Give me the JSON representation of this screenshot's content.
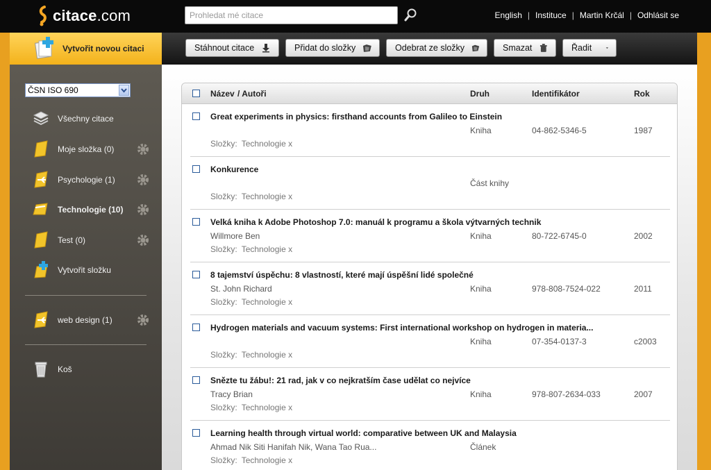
{
  "header": {
    "logo_text": "citace",
    "logo_suffix": ".com",
    "search_placeholder": "Prohledat mé citace",
    "nav": [
      "English",
      "Instituce",
      "Martin Krčál",
      "Odhlásit se"
    ]
  },
  "new_citation_label": "Vytvořit novou citaci",
  "toolbar": {
    "download": "Stáhnout citace",
    "add_to_folder": "Přidat do složky",
    "remove_from_folder": "Odebrat ze složky",
    "delete": "Smazat",
    "sort": "Řadit"
  },
  "sidebar": {
    "style_select": "ČSN ISO 690",
    "items": [
      {
        "label": "Všechny citace"
      },
      {
        "label": "Moje složka (0)"
      },
      {
        "label": "Psychologie (1)"
      },
      {
        "label": "Technologie (10)"
      },
      {
        "label": "Test (0)"
      },
      {
        "label": "Vytvořit složku"
      },
      {
        "label": "web design (1)"
      },
      {
        "label": "Koš"
      }
    ]
  },
  "list": {
    "headers": {
      "name": "Název",
      "authors": "/ Autoři",
      "kind": "Druh",
      "identifier": "Identifikátor",
      "year": "Rok"
    },
    "folders_label": "Složky:",
    "rows": [
      {
        "title": "Great experiments in physics: firsthand accounts from Galileo to Einstein",
        "author": "",
        "kind": "Kniha",
        "identifier": "04-862-5346-5",
        "year": "1987",
        "folders": "Technologie x"
      },
      {
        "title": "Konkurence",
        "author": "",
        "kind": "Část knihy",
        "identifier": "",
        "year": "",
        "folders": "Technologie x"
      },
      {
        "title": "Velká kniha k Adobe Photoshop 7.0: manuál k programu a škola výtvarných technik",
        "author": "Willmore Ben",
        "kind": "Kniha",
        "identifier": "80-722-6745-0",
        "year": "2002",
        "folders": "Technologie x"
      },
      {
        "title": "8 tajemství úspěchu: 8 vlastností, které mají úspěšní lidé společné",
        "author": "St. John Richard",
        "kind": "Kniha",
        "identifier": "978-808-7524-022",
        "year": "2011",
        "folders": "Technologie x"
      },
      {
        "title": "Hydrogen materials and vacuum systems: First international workshop on hydrogen in materia...",
        "author": "",
        "kind": "Kniha",
        "identifier": "07-354-0137-3",
        "year": "c2003",
        "folders": "Technologie x"
      },
      {
        "title": "Snězte tu žábu!: 21 rad, jak v co nejkratším čase udělat co nejvíce",
        "author": "Tracy Brian",
        "kind": "Kniha",
        "identifier": "978-807-2634-033",
        "year": "2007",
        "folders": "Technologie x"
      },
      {
        "title": "Learning health through virtual world: comparative between UK and Malaysia",
        "author": "Ahmad Nik Siti Hanifah Nik, Wana Tao Rua...",
        "kind": "Článek",
        "identifier": "",
        "year": "",
        "folders": "Technologie x"
      }
    ]
  }
}
